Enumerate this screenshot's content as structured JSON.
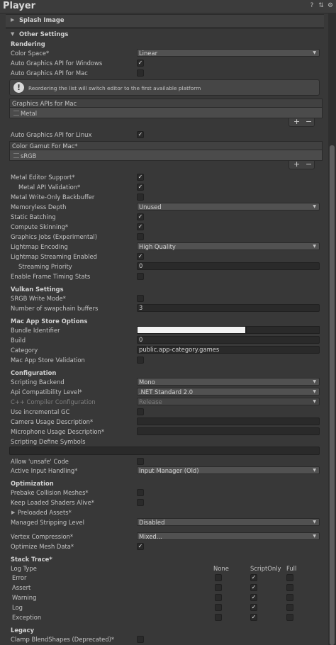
{
  "header": {
    "title": "Player"
  },
  "splash": {
    "label": "Splash Image"
  },
  "other": {
    "label": "Other Settings"
  },
  "rendering": {
    "title": "Rendering",
    "color_space": {
      "label": "Color Space*",
      "value": "Linear"
    },
    "auto_win": {
      "label": "Auto Graphics API  for Windows"
    },
    "auto_mac": {
      "label": "Auto Graphics API  for Mac"
    },
    "help": "Reordering the list will switch editor to the first available platform",
    "gfx_mac": {
      "header": "Graphics APIs for Mac",
      "item": "Metal"
    },
    "auto_linux": {
      "label": "Auto Graphics API  for Linux"
    },
    "gamut": {
      "header": "Color Gamut For Mac*",
      "item": "sRGB"
    },
    "list_plus": "+",
    "list_minus": "−"
  },
  "metal": {
    "editor_support": "Metal Editor Support*",
    "api_validation": "Metal API Validation*",
    "write_only": "Metal Write-Only Backbuffer",
    "memoryless": {
      "label": "Memoryless Depth",
      "value": "Unused"
    },
    "static_batching": "Static Batching",
    "compute_skinning": "Compute Skinning*",
    "graphics_jobs": "Graphics Jobs (Experimental)",
    "lightmap_encoding": {
      "label": "Lightmap Encoding",
      "value": "High Quality"
    },
    "lightmap_streaming": "Lightmap Streaming Enabled",
    "streaming_priority": {
      "label": "Streaming Priority",
      "value": "0"
    },
    "frame_timing": "Enable Frame Timing Stats"
  },
  "vulkan": {
    "title": "Vulkan Settings",
    "srgb_write": "SRGB Write Mode*",
    "swapchain": {
      "label": "Number of swapchain buffers",
      "value": "3"
    }
  },
  "mac_store": {
    "title": "Mac App Store Options",
    "bundle": {
      "label": "Bundle Identifier"
    },
    "build": {
      "label": "Build",
      "value": "0"
    },
    "category": {
      "label": "Category",
      "value": "public.app-category.games"
    },
    "validation": "Mac App Store Validation"
  },
  "config": {
    "title": "Configuration",
    "backend": {
      "label": "Scripting Backend",
      "value": "Mono"
    },
    "api_level": {
      "label": "Api Compatibility Level*",
      "value": ".NET Standard 2.0"
    },
    "cpp_config": {
      "label": "C++ Compiler Configuration",
      "value": "Release"
    },
    "incremental_gc": "Use incremental GC",
    "camera_usage": "Camera Usage Description*",
    "mic_usage": "Microphone Usage Description*",
    "define_symbols": "Scripting Define Symbols",
    "unsafe": "Allow 'unsafe' Code",
    "input_handling": {
      "label": "Active Input Handling*",
      "value": "Input Manager (Old)"
    }
  },
  "optimization": {
    "title": "Optimization",
    "prebake": "Prebake Collision Meshes*",
    "keep_shaders": "Keep Loaded Shaders Alive*",
    "preloaded": "Preloaded Assets*",
    "stripping": {
      "label": "Managed Stripping Level",
      "value": "Disabled"
    },
    "vertex": {
      "label": "Vertex Compression*",
      "value": "Mixed..."
    },
    "optimize_mesh": "Optimize Mesh Data*"
  },
  "stack": {
    "title": "Stack Trace*",
    "log_type": "Log Type",
    "columns": [
      "None",
      "ScriptOnly",
      "Full"
    ],
    "rows": [
      "Error",
      "Assert",
      "Warning",
      "Log",
      "Exception"
    ]
  },
  "legacy": {
    "title": "Legacy",
    "clamp": "Clamp BlendShapes (Deprecated)*"
  },
  "icons": [
    "help-icon",
    "preset-icon",
    "gear-icon",
    "foldout-arrow-icon",
    "dropdown-caret-icon",
    "checkmark-icon",
    "info-icon",
    "list-handle-icon"
  ]
}
